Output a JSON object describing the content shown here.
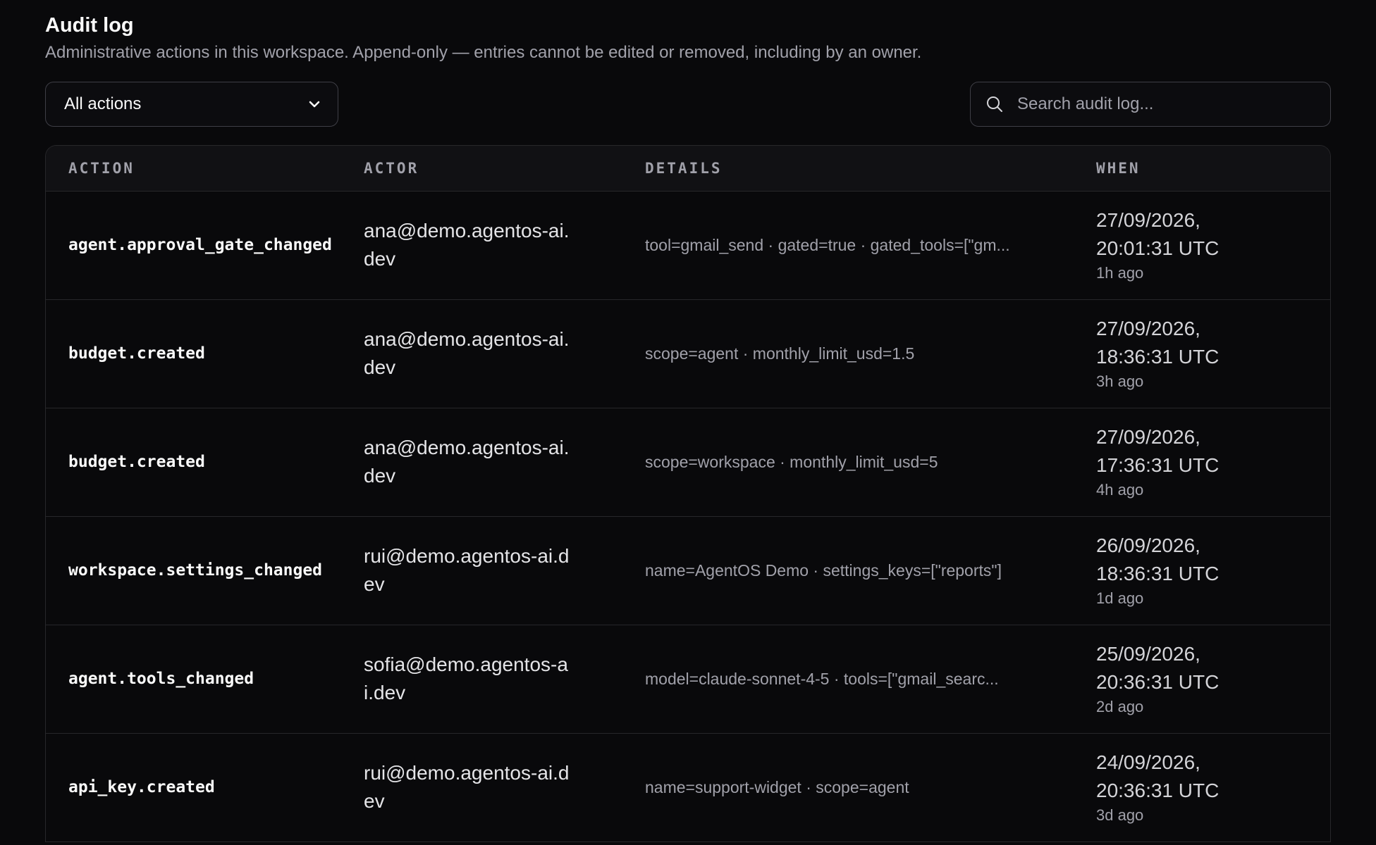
{
  "header": {
    "title": "Audit log",
    "subtitle": "Administrative actions in this workspace. Append-only — entries cannot be edited or removed, including by an owner."
  },
  "filter": {
    "selected": "All actions",
    "icon": "chevron-down-icon"
  },
  "search": {
    "placeholder": "Search audit log...",
    "value": "",
    "icon": "search-icon"
  },
  "table": {
    "columns": [
      "ACTION",
      "ACTOR",
      "DETAILS",
      "WHEN"
    ],
    "rows": [
      {
        "action": "agent.approval_gate_changed",
        "actor": "ana@demo.agentos-ai.dev",
        "details": "tool=gmail_send · gated=true · gated_tools=[\"gm...",
        "when_date": "27/09/2026, 20:01:31 UTC",
        "when_rel": "1h ago"
      },
      {
        "action": "budget.created",
        "actor": "ana@demo.agentos-ai.dev",
        "details": "scope=agent · monthly_limit_usd=1.5",
        "when_date": "27/09/2026, 18:36:31 UTC",
        "when_rel": "3h ago"
      },
      {
        "action": "budget.created",
        "actor": "ana@demo.agentos-ai.dev",
        "details": "scope=workspace · monthly_limit_usd=5",
        "when_date": "27/09/2026, 17:36:31 UTC",
        "when_rel": "4h ago"
      },
      {
        "action": "workspace.settings_changed",
        "actor": "rui@demo.agentos-ai.dev",
        "details": "name=AgentOS Demo · settings_keys=[\"reports\"]",
        "when_date": "26/09/2026, 18:36:31 UTC",
        "when_rel": "1d ago"
      },
      {
        "action": "agent.tools_changed",
        "actor": "sofia@demo.agentos-ai.dev",
        "details": "model=claude-sonnet-4-5 · tools=[\"gmail_searc...",
        "when_date": "25/09/2026, 20:36:31 UTC",
        "when_rel": "2d ago"
      },
      {
        "action": "api_key.created",
        "actor": "rui@demo.agentos-ai.dev",
        "details": "name=support-widget · scope=agent",
        "when_date": "24/09/2026, 20:36:31 UTC",
        "when_rel": "3d ago"
      }
    ]
  },
  "colors": {
    "background": "#09090b",
    "border": "#27272a",
    "text": "#fafafa",
    "muted": "#a1a1aa"
  }
}
